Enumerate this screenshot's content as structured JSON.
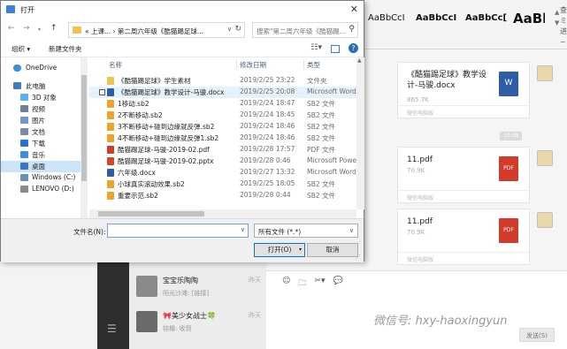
{
  "word_ribbon": {
    "styles": [
      "AaBbCcI",
      "AaBbCcI",
      "AaBbCc[",
      "AaBb"
    ],
    "side_chars": [
      "查",
      "ミ",
      "进",
      "~"
    ]
  },
  "wechat": {
    "messages": [
      {
        "name": "《酷猫踢足球》教学设计-马骏.docx",
        "size": "865.7K",
        "icon": "W",
        "footer": "微信电脑版"
      },
      {
        "name": "11.pdf",
        "size": "70.9K",
        "icon": "PDF",
        "footer": "微信电脑版"
      },
      {
        "name": "11.pdf",
        "size": "70.9K",
        "icon": "PDF",
        "footer": "微信电脑版"
      }
    ],
    "time_pill": "10:38",
    "conversations": [
      {
        "name": "宝宝乐陶陶",
        "preview": "阳光沙滩: [链接]",
        "time": "昨天"
      },
      {
        "name": "🎀美少女战士🍀",
        "preview": "铭楷: 收到",
        "time": "昨天"
      }
    ],
    "composer_tools": [
      "☺",
      "🗀",
      "✂▾",
      "💬"
    ],
    "send_label": "发送(S)"
  },
  "watermark": "微信号: hxy-haoxingyun",
  "dialog": {
    "title": "打开",
    "breadcrumb": "« 上课... › 第二周六年级《酷猫踢足球...",
    "search_placeholder": "搜索\"第二周六年级《酷猫踢...",
    "toolbar": {
      "organize": "组织 ▾",
      "new_folder": "新建文件夹"
    },
    "columns": {
      "name": "名称",
      "date": "修改日期",
      "type": "类型"
    },
    "nav_items": [
      {
        "label": "OneDrive",
        "icon": "cloud",
        "color": "#3b8ed9"
      },
      {
        "label": "此电脑",
        "icon": "computer",
        "color": "#3a7fc5"
      },
      {
        "label": "3D 对象",
        "icon": "cube",
        "color": "#5ab0e8"
      },
      {
        "label": "视频",
        "icon": "video",
        "color": "#6e7f96"
      },
      {
        "label": "图片",
        "icon": "pictures",
        "color": "#6e96c8"
      },
      {
        "label": "文档",
        "icon": "documents",
        "color": "#7a8ca6"
      },
      {
        "label": "下载",
        "icon": "download",
        "color": "#2a73c9"
      },
      {
        "label": "音乐",
        "icon": "music",
        "color": "#3d8de0"
      },
      {
        "label": "桌面",
        "icon": "desktop",
        "color": "#3a78c2"
      },
      {
        "label": "Windows (C:)",
        "icon": "drive",
        "color": "#6a8fb8"
      },
      {
        "label": "LENOVO (D:)",
        "icon": "drive",
        "color": "#8a8a8a"
      }
    ],
    "files": [
      {
        "name": "《酷猫踢足球》学生素材",
        "date": "2019/2/25 23:22",
        "type": "文件夹",
        "icon": "folder",
        "color": "#f1c24c"
      },
      {
        "name": "《酷猫踢足球》教学设计-马骏.docx",
        "date": "2019/2/25 20:08",
        "type": "Microsoft Word ...",
        "icon": "word",
        "color": "#2f5ea8"
      },
      {
        "name": "1移动.sb2",
        "date": "2019/2/24 18:47",
        "type": "SB2 文件",
        "icon": "sb2",
        "color": "#f0a32b"
      },
      {
        "name": "2不断移动.sb2",
        "date": "2019/2/24 18:45",
        "type": "SB2 文件",
        "icon": "sb2",
        "color": "#f0a32b"
      },
      {
        "name": "3不断移动+碰到边缘就反弹.sb2",
        "date": "2019/2/24 18:46",
        "type": "SB2 文件",
        "icon": "sb2",
        "color": "#f0a32b"
      },
      {
        "name": "4不断移动+碰到边缘就反弹1.sb2",
        "date": "2019/2/24 18:46",
        "type": "SB2 文件",
        "icon": "sb2",
        "color": "#f0a32b"
      },
      {
        "name": "酷猫踢足球-马骏-2019-02.pdf",
        "date": "2019/2/28 17:57",
        "type": "PDF 文件",
        "icon": "pdf",
        "color": "#d23a2a"
      },
      {
        "name": "酷猫踢足球-马骏-2019-02.pptx",
        "date": "2019/2/28 0:46",
        "type": "Microsoft Power...",
        "icon": "ppt",
        "color": "#d24726"
      },
      {
        "name": "六年级.docx",
        "date": "2019/2/27 13:32",
        "type": "Microsoft Word ...",
        "icon": "word",
        "color": "#2f5ea8"
      },
      {
        "name": "小球真实滚动效果.sb2",
        "date": "2019/2/25 18:05",
        "type": "SB2 文件",
        "icon": "sb2",
        "color": "#f0a32b"
      },
      {
        "name": "重要示范.sb2",
        "date": "2019/2/28 0:44",
        "type": "SB2 文件",
        "icon": "sb2",
        "color": "#f0a32b"
      }
    ],
    "filename_label": "文件名(N):",
    "filename_value": "",
    "filter_value": "所有文件 (*.*)",
    "open_button": "打开(O)",
    "cancel_button": "取消"
  }
}
